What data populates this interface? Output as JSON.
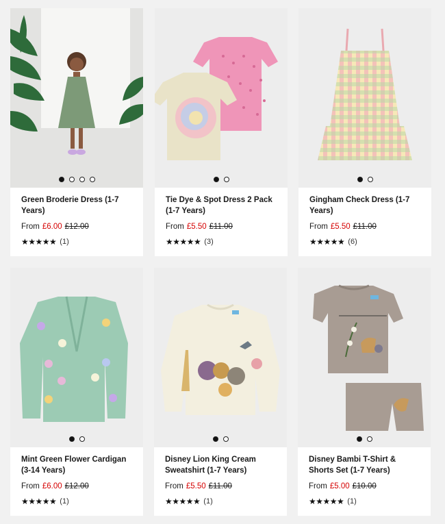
{
  "products": [
    {
      "title": "Green Broderie Dress (1-7 Years)",
      "from": "From",
      "price": "£6.00",
      "was": "£12.00",
      "stars": "★★★★★",
      "reviews": "(1)",
      "dots": 4,
      "active_dot": 0,
      "image_icon": "green-dress-photo"
    },
    {
      "title": "Tie Dye & Spot Dress 2 Pack (1-7 Years)",
      "from": "From",
      "price": "£5.50",
      "was": "£11.00",
      "stars": "★★★★★",
      "reviews": "(3)",
      "dots": 2,
      "active_dot": 0,
      "image_icon": "tie-dye-dress-photo"
    },
    {
      "title": "Gingham Check Dress (1-7 Years)",
      "from": "From",
      "price": "£5.50",
      "was": "£11.00",
      "stars": "★★★★★",
      "reviews": "(6)",
      "dots": 2,
      "active_dot": 0,
      "image_icon": "gingham-dress-photo"
    },
    {
      "title": "Mint Green Flower Cardigan (3-14 Years)",
      "from": "From",
      "price": "£6.00",
      "was": "£12.00",
      "stars": "★★★★★",
      "reviews": "(1)",
      "dots": 2,
      "active_dot": 0,
      "image_icon": "cardigan-photo"
    },
    {
      "title": "Disney Lion King Cream Sweatshirt (1-7 Years)",
      "from": "From",
      "price": "£5.50",
      "was": "£11.00",
      "stars": "★★★★★",
      "reviews": "(1)",
      "dots": 2,
      "active_dot": 0,
      "image_icon": "sweatshirt-photo"
    },
    {
      "title": "Disney Bambi T-Shirt & Shorts Set (1-7 Years)",
      "from": "From",
      "price": "£5.00",
      "was": "£10.00",
      "stars": "★★★★★",
      "reviews": "(1)",
      "dots": 2,
      "active_dot": 0,
      "image_icon": "bambi-set-photo"
    }
  ],
  "colors": {
    "sale_price": "#d50000",
    "page_bg": "#f1f1f1",
    "card_bg": "#ffffff",
    "image_bg": "#ececec"
  }
}
